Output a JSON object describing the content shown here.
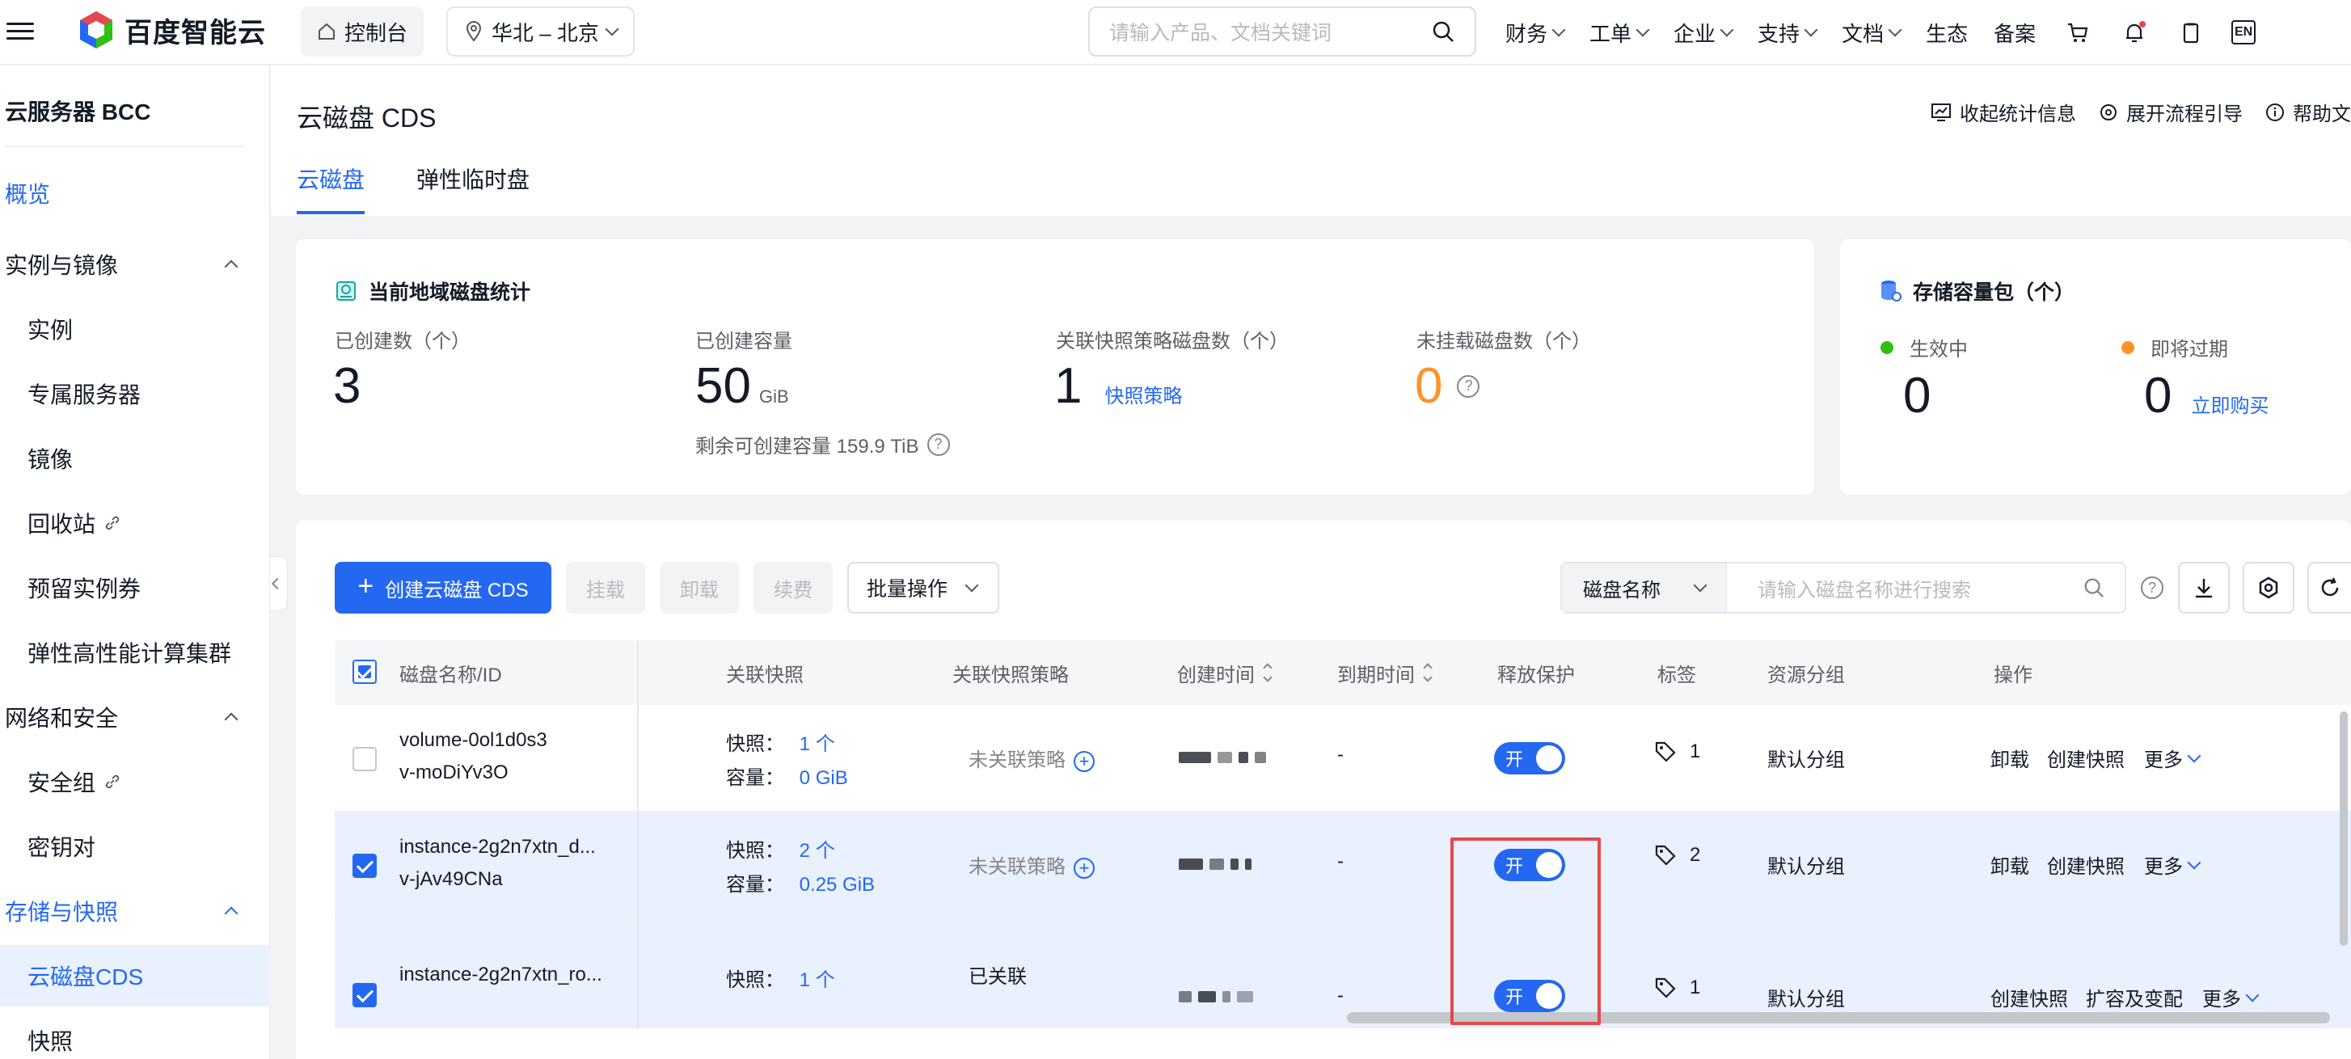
{
  "topbar": {
    "brand": "百度智能云",
    "console": "控制台",
    "region": "华北 – 北京",
    "search_placeholder": "请输入产品、文档关键词",
    "nav": [
      "财务",
      "工单",
      "企业",
      "支持",
      "文档"
    ],
    "nav_plain": [
      "生态",
      "备案"
    ],
    "lang": "EN"
  },
  "sidebar": {
    "title": "云服务器 BCC",
    "overview": "概览",
    "groups": [
      {
        "label": "实例与镜像",
        "items": [
          "实例",
          "专属服务器",
          "镜像",
          "回收站",
          "预留实例券",
          "弹性高性能计算集群"
        ]
      },
      {
        "label": "网络和安全",
        "items": [
          "安全组",
          "密钥对"
        ]
      },
      {
        "label": "存储与快照",
        "items": [
          "云磁盘CDS",
          "快照"
        ]
      }
    ]
  },
  "header": {
    "title": "云磁盘 CDS",
    "actions": [
      "收起统计信息",
      "展开流程引导",
      "帮助文"
    ],
    "tabs": [
      "云磁盘",
      "弹性临时盘"
    ]
  },
  "stats": {
    "title": "当前地域磁盘统计",
    "created_count_label": "已创建数（个）",
    "created_count": "3",
    "capacity_label": "已创建容量",
    "capacity": "50",
    "capacity_unit": "GiB",
    "remaining": "剩余可创建容量 159.9 TiB",
    "snapshot_policy_label": "关联快照策略磁盘数（个）",
    "snapshot_policy_count": "1",
    "snapshot_policy_link": "快照策略",
    "unmounted_label": "未挂载磁盘数（个）",
    "unmounted_count": "0"
  },
  "storage_pack": {
    "title": "存储容量包（个）",
    "active_label": "生效中",
    "active_count": "0",
    "expiring_label": "即将过期",
    "expiring_count": "0",
    "buy_link": "立即购买",
    "active_color": "#30bf13",
    "expiring_color": "#ff9326"
  },
  "toolbar": {
    "create": "创建云磁盘 CDS",
    "mount": "挂载",
    "unmount": "卸载",
    "renew": "续费",
    "batch": "批量操作",
    "search_field": "磁盘名称",
    "search_placeholder": "请输入磁盘名称进行搜索"
  },
  "table": {
    "columns": {
      "name": "磁盘名称/ID",
      "snapshot": "关联快照",
      "policy": "关联快照策略",
      "created": "创建时间",
      "expire": "到期时间",
      "protect": "释放保护",
      "tag": "标签",
      "group": "资源分组",
      "ops": "操作"
    },
    "snap_label": "快照：",
    "cap_label": "容量：",
    "rows": [
      {
        "name": "volume-0ol1d0s3",
        "id": "v-moDiYv3O",
        "snap_count": "1 个",
        "cap": "0 GiB",
        "policy": "未关联策略",
        "expire": "-",
        "toggle": "开",
        "tags": "1",
        "group": "默认分组",
        "ops": [
          "卸载",
          "创建快照",
          "更多"
        ]
      },
      {
        "name": "instance-2g2n7xtn_d...",
        "id": "v-jAv49CNa",
        "snap_count": "2 个",
        "cap": "0.25 GiB",
        "policy": "未关联策略",
        "expire": "-",
        "toggle": "开",
        "tags": "2",
        "group": "默认分组",
        "ops": [
          "卸载",
          "创建快照",
          "更多"
        ]
      },
      {
        "name": "instance-2g2n7xtn_ro...",
        "id": "",
        "snap_count": "1 个",
        "cap": "",
        "policy": "已关联",
        "expire": "-",
        "toggle": "开",
        "tags": "1",
        "group": "默认分组",
        "ops": [
          "创建快照",
          "扩容及变配",
          "更多"
        ]
      }
    ]
  }
}
